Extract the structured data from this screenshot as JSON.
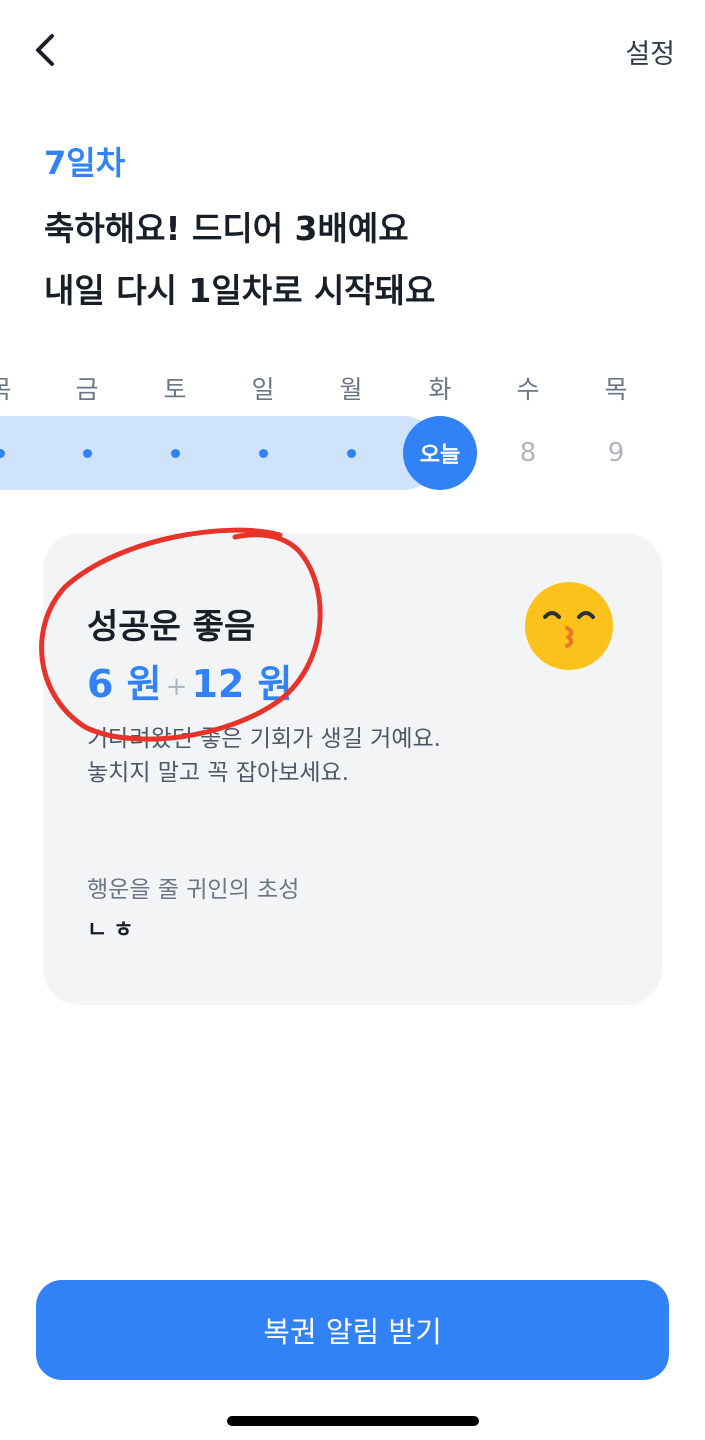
{
  "header": {
    "back_icon": "chevron-left-icon",
    "settings_label": "설정"
  },
  "streak": {
    "day_label": "7일차",
    "headline_line1": "축하해요! 드디어 3배예요",
    "headline_line2": "내일 다시 1일차로 시작돼요"
  },
  "week": {
    "weekdays": [
      "목",
      "금",
      "토",
      "일",
      "월",
      "화",
      "수",
      "목"
    ],
    "today_label": "오늘",
    "future_days": [
      "8",
      "9"
    ],
    "track_color": "#cfe3fd",
    "accent_color": "#3182f6"
  },
  "fortune": {
    "title": "성공운 좋음",
    "amount_base": "6 원",
    "plus": "+",
    "amount_bonus": "12 원",
    "emoji_icon": "kissing-face-icon",
    "description_line1": "기다려왔던 좋은 기회가 생길 거예요.",
    "description_line2": "놓치지 말고 꼭 잡아보세요.",
    "lucky_person_label": "행운을 줄 귀인의 초성",
    "lucky_initials": "ㄴㅎ",
    "annotation_color": "#e8332a"
  },
  "cta": {
    "label": "복권 알림 받기"
  }
}
